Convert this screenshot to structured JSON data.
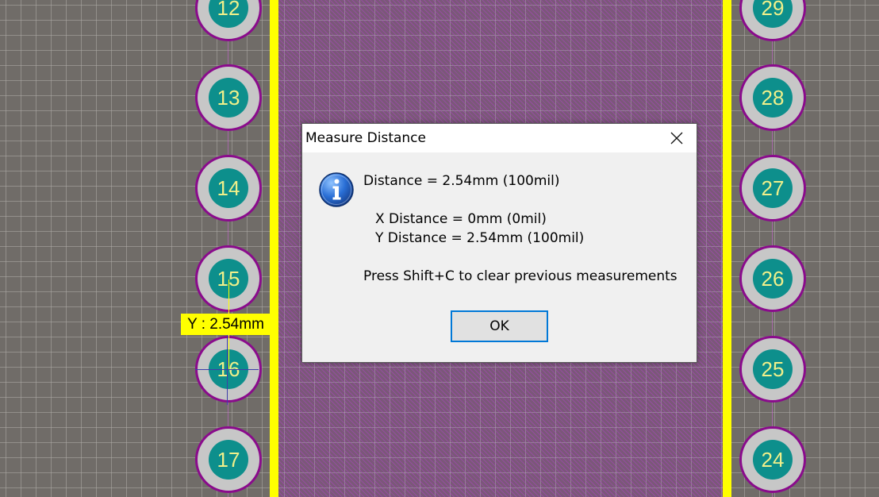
{
  "canvas": {
    "background_color": "#706c68",
    "component_body_color": "#7a5878",
    "silkscreen_color": "#ffff00",
    "pad_ring_color": "#8a0b8c",
    "pad_copper_color": "#c7c7c7",
    "pad_hole_color": "#0d8f8c",
    "pad_label_color": "#f0f08a",
    "left_pads": [
      "12",
      "13",
      "14",
      "15",
      "16",
      "17"
    ],
    "right_pads": [
      "29",
      "28",
      "27",
      "26",
      "25",
      "24"
    ],
    "measure_label": "Y : 2.54mm"
  },
  "dialog": {
    "title": "Measure Distance",
    "close_icon": "close-icon",
    "info_icon": "info-icon",
    "distance_line": "Distance = 2.54mm (100mil)",
    "x_distance_line": "X Distance = 0mm (0mil)",
    "y_distance_line": "Y Distance = 2.54mm (100mil)",
    "hint_line": "Press Shift+C to clear previous measurements",
    "ok_label": "OK",
    "accent_color": "#0078d7"
  }
}
